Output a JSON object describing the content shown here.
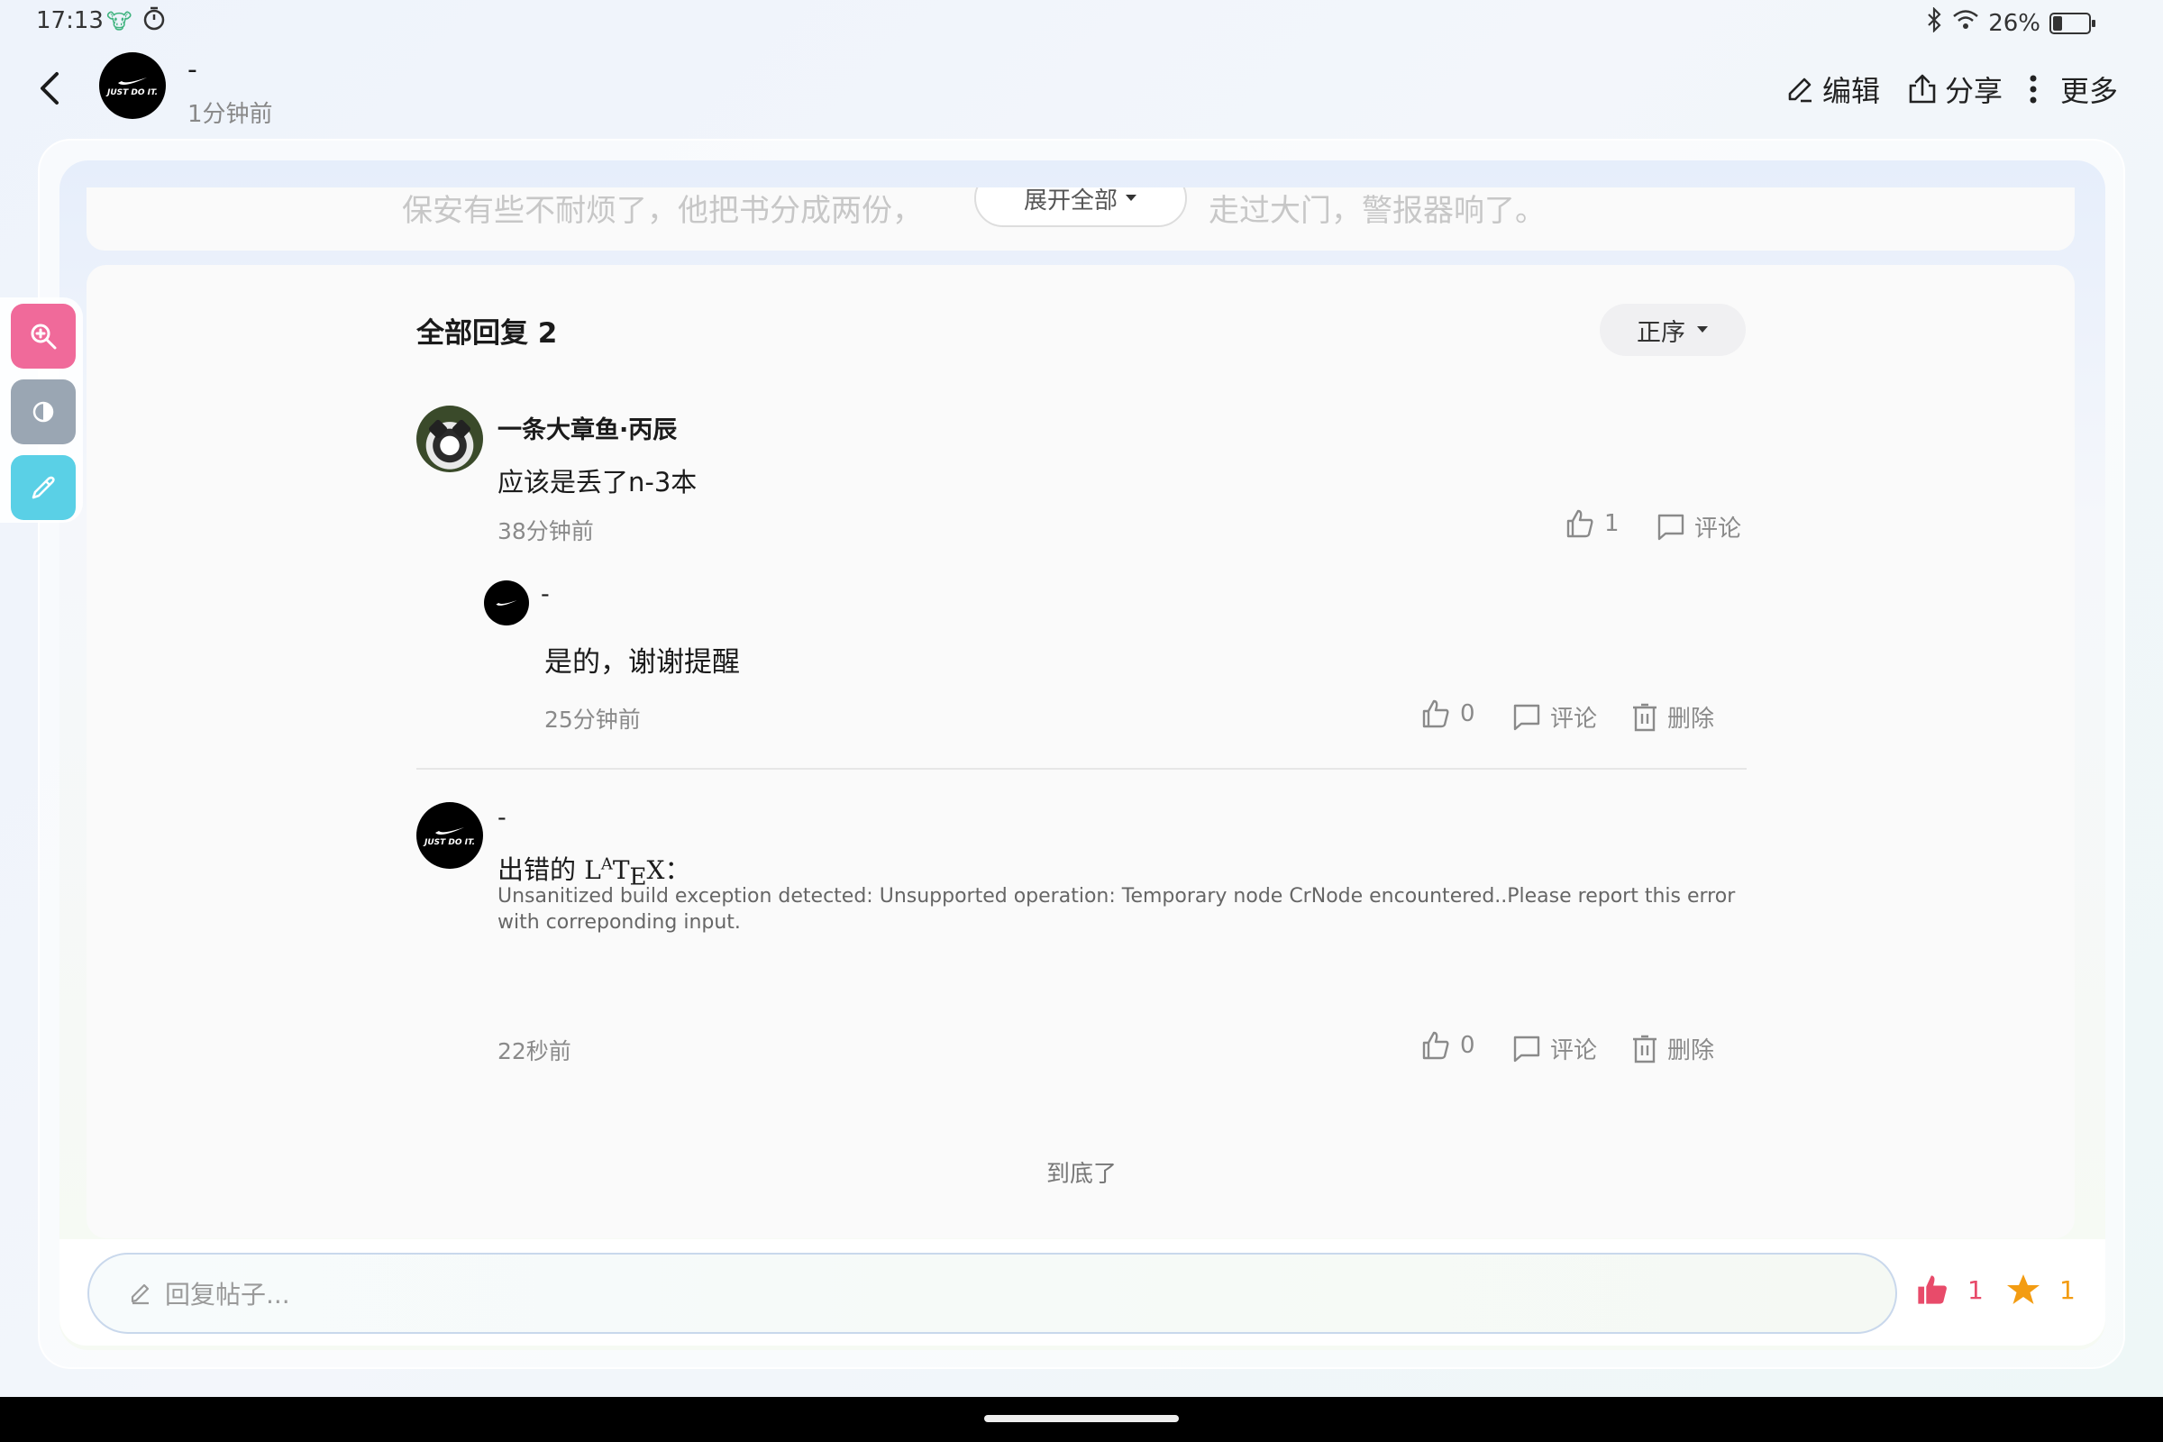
{
  "status_bar": {
    "time": "17:13",
    "battery": "26%",
    "battery_level": 0.26
  },
  "header": {
    "author_name": "-",
    "post_time": "1分钟前",
    "edit_label": "编辑",
    "share_label": "分享",
    "more_label": "更多",
    "avatar_text": "JUST DO IT."
  },
  "previous_post": {
    "text_left": "保安有些不耐烦了，他把书分成两份，",
    "expand_label": "展开全部",
    "text_right": "走过大门，警报器响了。"
  },
  "replies": {
    "title": "全部回复 2",
    "sort_label": "正序",
    "items": [
      {
        "name": "一条大章鱼·丙辰",
        "text": "应该是丢了n-3本",
        "time": "38分钟前",
        "likes": "1",
        "comment_label": "评论",
        "sub_reply": {
          "name": "-",
          "text": "是的，谢谢提醒",
          "time": "25分钟前",
          "likes": "0",
          "comment_label": "评论",
          "delete_label": "删除"
        }
      },
      {
        "name": "-",
        "latex_prefix": "出错的",
        "latex_suffix": "：",
        "error_text": "Unsanitized build exception detected: Unsupported operation: Temporary node CrNode encountered..Please report this error with correponding input.",
        "time": "22秒前",
        "likes": "0",
        "comment_label": "评论",
        "delete_label": "删除"
      }
    ],
    "end_label": "到底了"
  },
  "bottom_bar": {
    "reply_placeholder": "回复帖子...",
    "like_count": "1",
    "favorite_count": "1"
  },
  "colors": {
    "like": "#e84b6a",
    "star": "#f39c12",
    "tool_zoom": "#f06a9a",
    "tool_contrast": "#9aa6b3",
    "tool_picker": "#5ad0e6"
  }
}
